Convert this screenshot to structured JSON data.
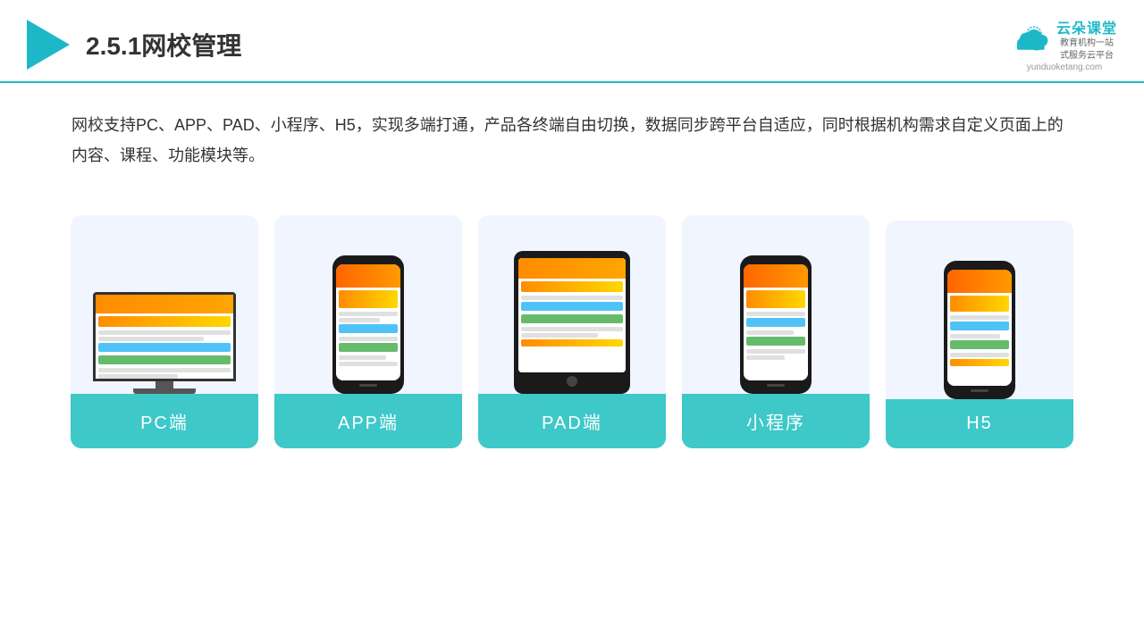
{
  "header": {
    "title": "2.5.1网校管理",
    "brand": {
      "name_cn": "云朵课堂",
      "url": "yunduoketang.com",
      "tagline_line1": "教育机构一站",
      "tagline_line2": "式服务云平台"
    }
  },
  "description": {
    "text": "网校支持PC、APP、PAD、小程序、H5，实现多端打通，产品各终端自由切换，数据同步跨平台自适应，同时根据机构需求自定义页面上的内容、课程、功能模块等。"
  },
  "cards": [
    {
      "id": "pc",
      "label": "PC端"
    },
    {
      "id": "app",
      "label": "APP端"
    },
    {
      "id": "pad",
      "label": "PAD端"
    },
    {
      "id": "miniprogram",
      "label": "小程序"
    },
    {
      "id": "h5",
      "label": "H5"
    }
  ],
  "colors": {
    "teal": "#3ec8c8",
    "accent": "#1db8c8",
    "divider": "#1db8c8"
  }
}
